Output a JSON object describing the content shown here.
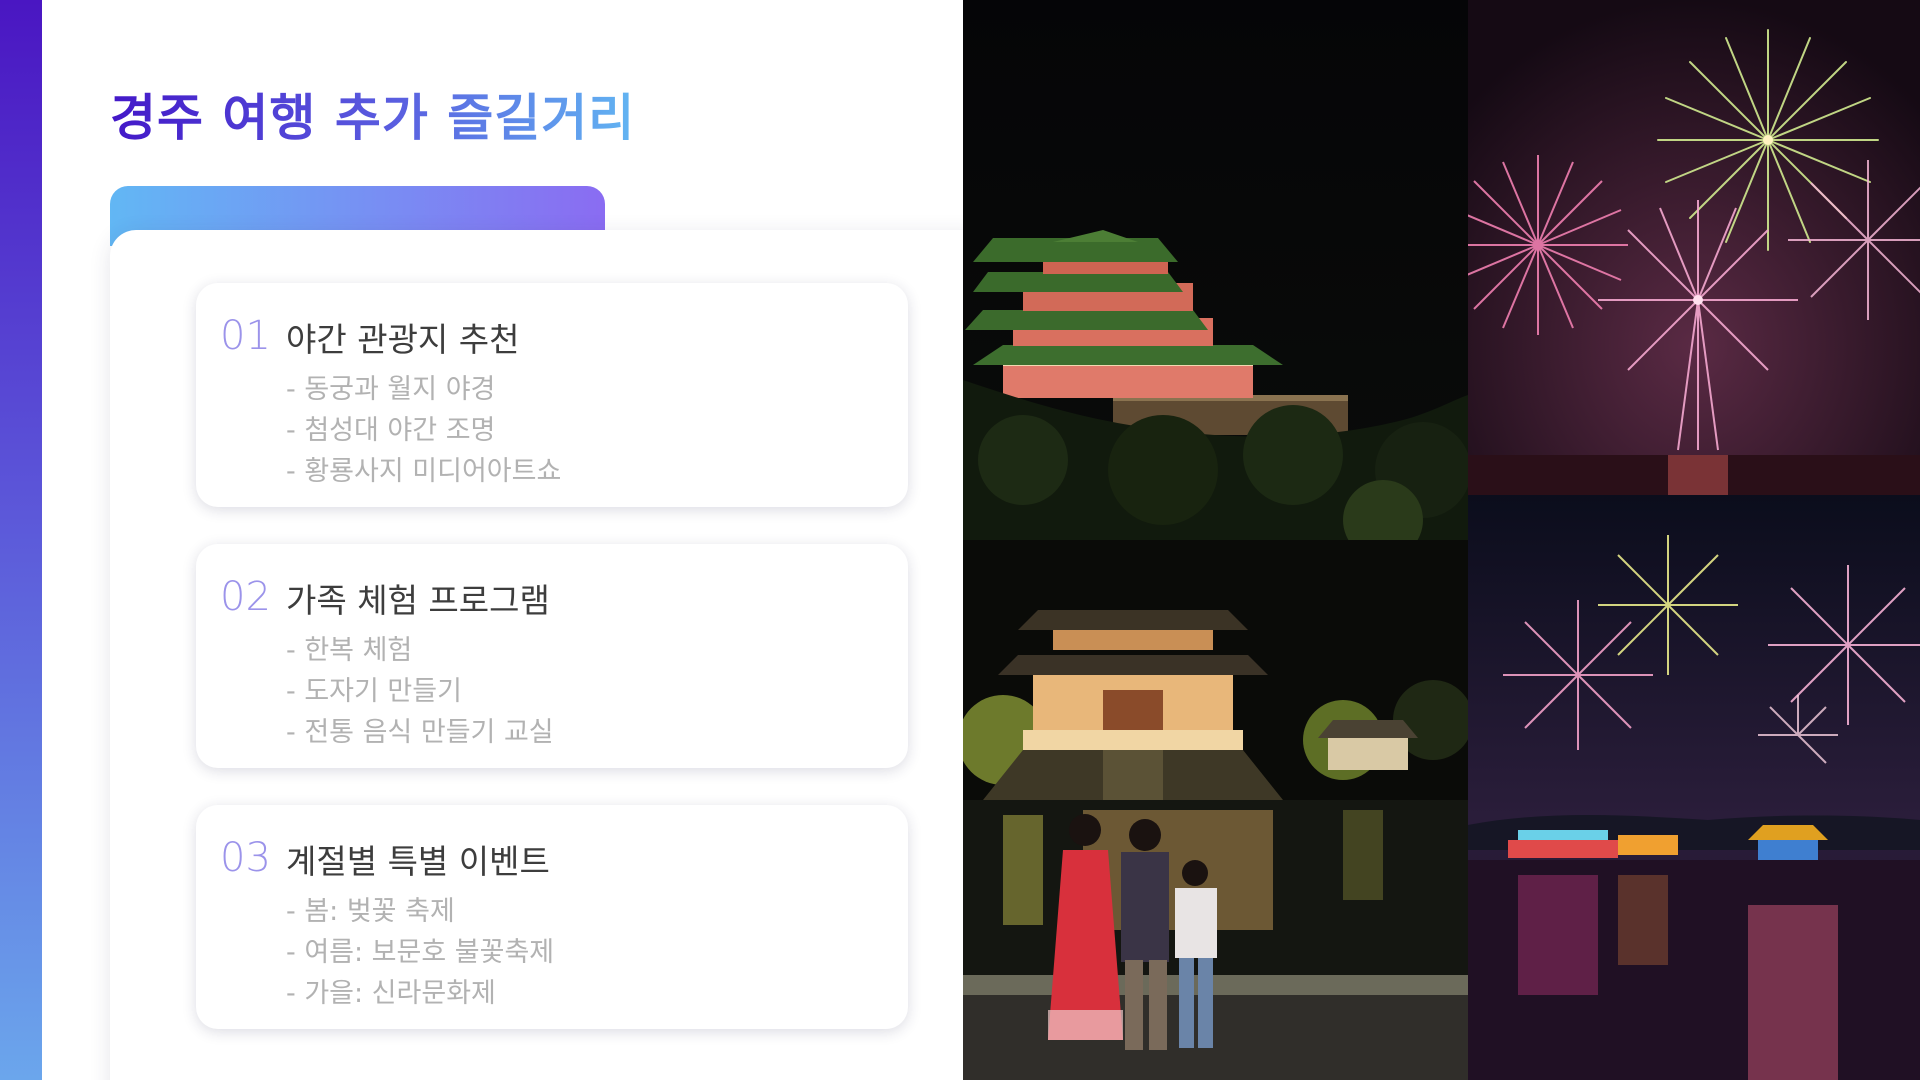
{
  "title": "경주 여행 추가 즐길거리",
  "cards": [
    {
      "number": "01",
      "title": "야간 관광지 추천",
      "items": [
        "- 동궁과 월지 야경",
        "- 첨성대 야간 조명",
        "- 황룡사지 미디어아트쇼"
      ]
    },
    {
      "number": "02",
      "title": "가족 체험 프로그램",
      "items": [
        "- 한복 체험",
        "- 도자기 만들기",
        "- 전통 음식 만들기 교실"
      ]
    },
    {
      "number": "03",
      "title": "계절별 특별 이벤트",
      "items": [
        "- 봄: 벚꽃 축제",
        "- 여름: 보문호 불꽃축제",
        "- 가을: 신라문화제"
      ]
    }
  ],
  "photos": [
    {
      "name": "night-pavilion-on-hill-photo"
    },
    {
      "name": "fireworks-sky-photo"
    },
    {
      "name": "family-at-night-pavilion-lake-photo"
    },
    {
      "name": "fireworks-over-lake-photo"
    }
  ],
  "colors": {
    "accent_dark": "#4318c8",
    "accent_light": "#62b5f2",
    "number": "#9b93ea",
    "card_title": "#3d3d3d",
    "card_item": "#b2b2b2"
  }
}
